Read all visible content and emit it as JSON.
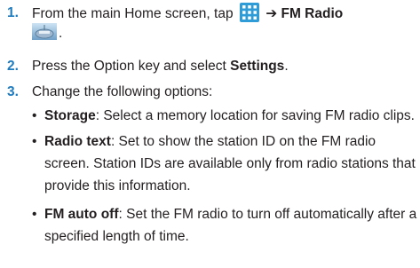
{
  "steps": [
    {
      "number": "1.",
      "text_before_icon": "From the main Home screen, tap",
      "arrow": "➔",
      "app_name": "FM Radio",
      "trailing": "."
    },
    {
      "number": "2.",
      "text_before": "Press the Option key and select",
      "bold": "Settings",
      "trailing": "."
    },
    {
      "number": "3.",
      "text": "Change the following options:"
    }
  ],
  "options": [
    {
      "label": "Storage",
      "lines": [
        ": Select a memory location for saving FM radio clips."
      ]
    },
    {
      "label": "Radio text",
      "lines": [
        ": Set to show the station ID on the FM radio",
        "screen. Station IDs are available only from radio stations that",
        "provide this information."
      ]
    },
    {
      "label": "FM auto off",
      "lines": [
        ": Set the FM radio to turn off automatically after a",
        "specified length of time."
      ]
    }
  ],
  "bullet_glyph": "•",
  "icons": {
    "menu": "apps-grid-icon",
    "radio": "fm-radio-app-icon"
  },
  "colors": {
    "step_number": "#1e7bbf",
    "grid_icon": "#2f9bd7",
    "text": "#231f20"
  }
}
